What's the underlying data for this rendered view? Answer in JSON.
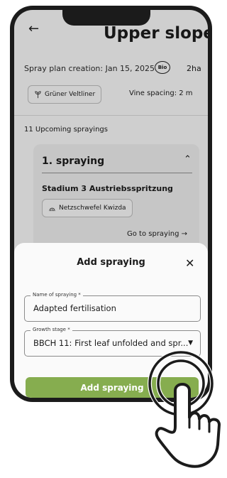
{
  "header": {
    "title": "Upper slope",
    "back_icon": "arrow-left-icon"
  },
  "plan": {
    "creation_label": "Spray plan creation: Jan 15, 2025",
    "bio_badge": "Bio",
    "area": "2ha",
    "variety": "Grüner Veltliner",
    "vine_spacing": "Vine spacing: 2 m"
  },
  "upcoming_label": "11 Upcoming sprayings",
  "card": {
    "title": "1. spraying",
    "stadium": "Stadium 3 Austriebsspritzung",
    "agent": "Netzschwefel Kwizda",
    "goto_label": "Go to spraying →"
  },
  "sheet": {
    "title": "Add spraying",
    "name_field": {
      "label": "Name of spraying *",
      "value": "Adapted fertilisation"
    },
    "growth_field": {
      "label": "Growth stage *",
      "value": "BBCH 11: First leaf unfolded and spr..."
    },
    "submit_label": "Add spraying"
  },
  "colors": {
    "accent": "#86ad4f",
    "background": "#ececec",
    "frame": "#1b1b1b"
  }
}
